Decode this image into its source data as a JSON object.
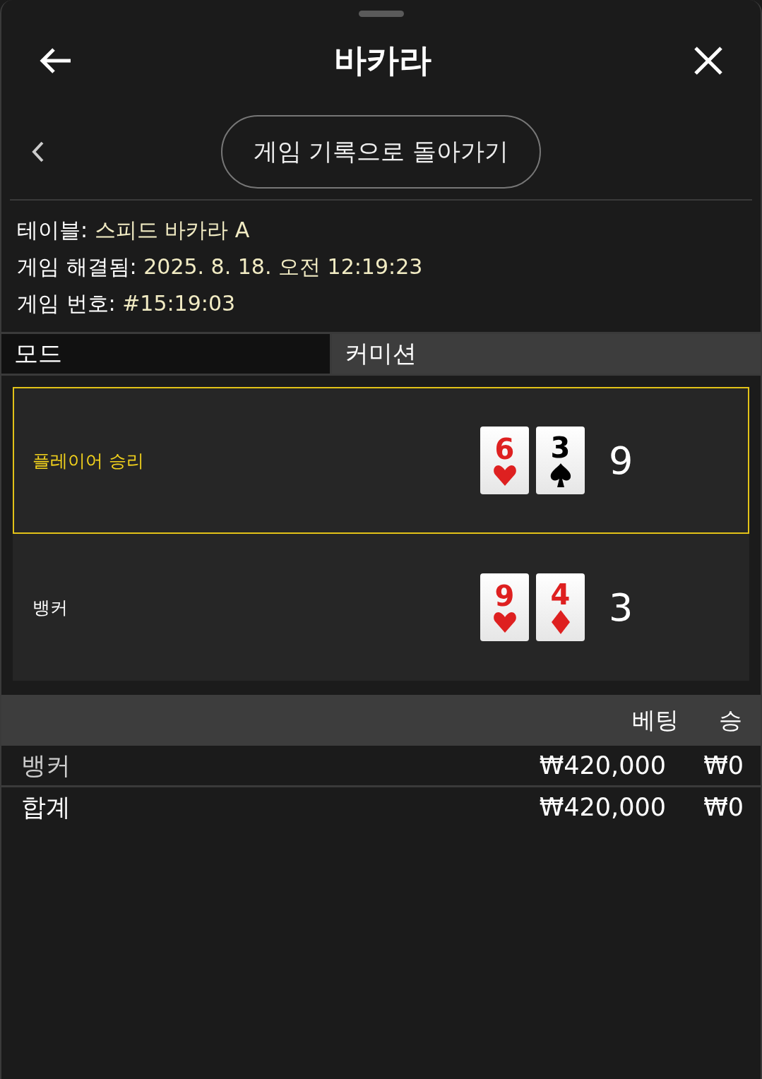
{
  "header": {
    "title": "바카라"
  },
  "back_button": {
    "label": "게임 기록으로 돌아가기"
  },
  "info": [
    {
      "label": "테이블:",
      "value": "스피드 바카라 A"
    },
    {
      "label": "게임 해결됨:",
      "value": "2025. 8. 18. 오전 12:19:23"
    },
    {
      "label": "게임 번호:",
      "value": "#15:19:03"
    }
  ],
  "mode_row": {
    "mode": "모드",
    "commission": "커미션"
  },
  "hands": [
    {
      "label": "플레이어 승리",
      "won": true,
      "cards": [
        {
          "rank": "6",
          "kind": "hearts"
        },
        {
          "rank": "3",
          "kind": "spades"
        }
      ],
      "total": "9"
    },
    {
      "label": "뱅커",
      "won": false,
      "cards": [
        {
          "rank": "9",
          "kind": "hearts"
        },
        {
          "rank": "4",
          "kind": "diamonds"
        }
      ],
      "total": "3"
    }
  ],
  "bets": {
    "columns": [
      "베팅",
      "승"
    ],
    "rows": [
      {
        "label": "뱅커",
        "bet": "₩420,000",
        "win": "₩0"
      }
    ],
    "total": {
      "label": "합계",
      "bet": "₩420,000",
      "win": "₩0"
    }
  }
}
